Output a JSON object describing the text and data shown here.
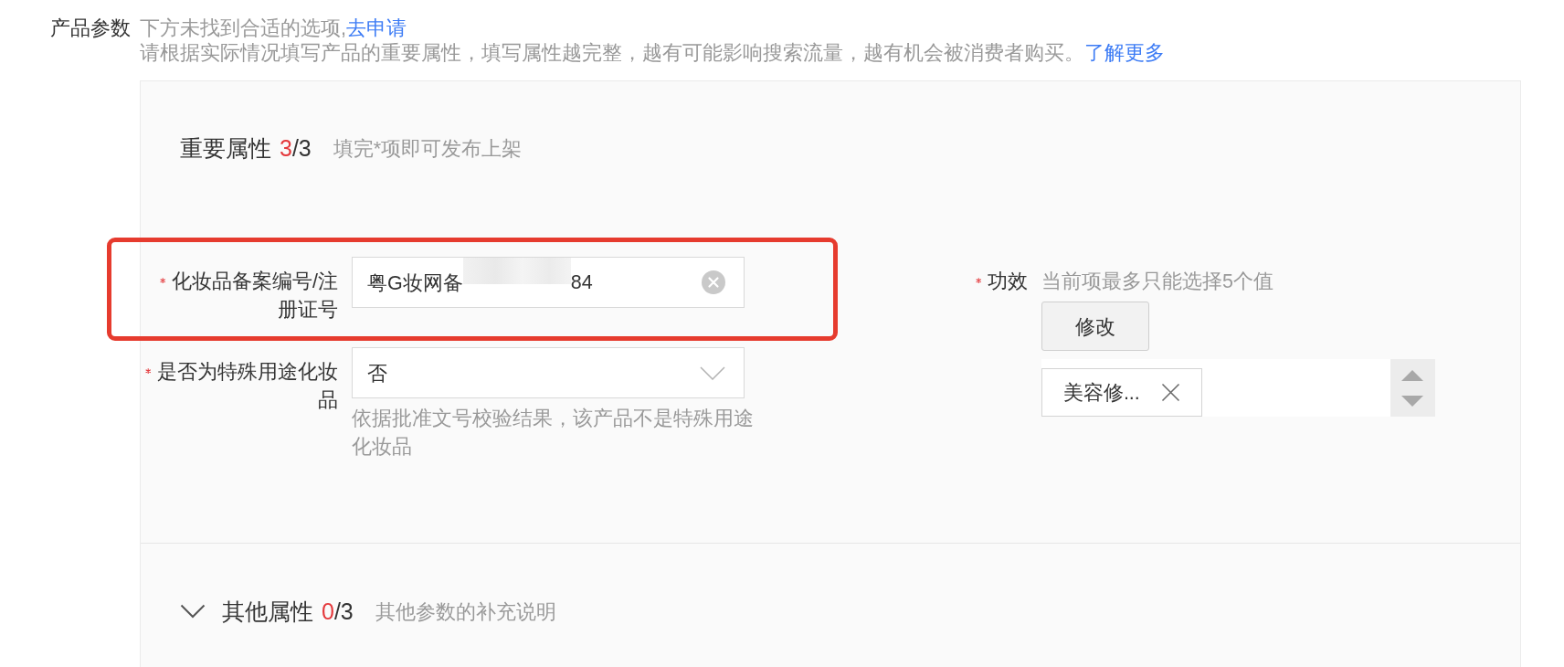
{
  "header": {
    "label": "产品参数",
    "notice": "下方未找到合适的选项,",
    "notice_link": "去申请",
    "description": "请根据实际情况填写产品的重要属性，填写属性越完整，越有可能影响搜索流量，越有机会被消费者购买。",
    "description_link": "了解更多"
  },
  "sections": [
    {
      "kind": "fixed",
      "title": "重要属性",
      "filled": "3",
      "total": "/3",
      "hint": "填完*项即可发布上架",
      "left_fields": [
        {
          "kind": "text",
          "label": "化妆品备案编号/注册证号",
          "required": true,
          "highlighted": true,
          "value": "粤G妆网备",
          "redacted": true,
          "value_end": "84"
        },
        {
          "kind": "select",
          "label": "是否为特殊用途化妆品",
          "required": true,
          "highlighted": false,
          "value": "否",
          "help": "依据批准文号校验结果，该产品不是特殊用途化妆品"
        }
      ],
      "right_fields": [
        {
          "kind": "tags",
          "label": "功效",
          "required": true,
          "hint": "当前项最多只能选择5个值",
          "button": "修改",
          "tags": [
            "美容修..."
          ]
        }
      ]
    },
    {
      "kind": "collapsible",
      "expanded": false,
      "title": "其他属性",
      "filled": "0",
      "total": "/3",
      "hint": "其他参数的补充说明"
    }
  ]
}
